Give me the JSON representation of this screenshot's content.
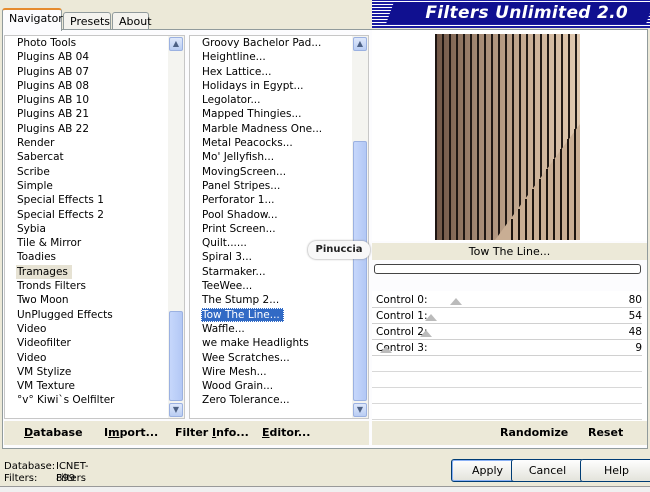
{
  "header": {
    "title": "Filters Unlimited 2.0"
  },
  "tabs": [
    {
      "label": "Navigator",
      "active": true
    },
    {
      "label": "Presets",
      "active": false
    },
    {
      "label": "About",
      "active": false
    }
  ],
  "categories": {
    "items": [
      "Photo Tools",
      "Plugins AB 04",
      "Plugins AB 07",
      "Plugins AB 08",
      "Plugins AB 10",
      "Plugins AB 21",
      "Plugins AB 22",
      "Render",
      "Sabercat",
      "Scribe",
      "Simple",
      "Special Effects 1",
      "Special Effects 2",
      "Sybia",
      "Tile & Mirror",
      "Toadies",
      "Tramages",
      "Tronds Filters",
      "Two Moon",
      "UnPlugged Effects",
      "Video",
      "Videofilter",
      "Video",
      "VM Stylize",
      "VM Texture",
      "°v° Kiwi`s Oelfilter"
    ],
    "selected": "Tramages"
  },
  "filters": {
    "items": [
      "Groovy Bachelor Pad...",
      "Heightline...",
      "Hex Lattice...",
      "Holidays in Egypt...",
      "Legolator...",
      "Mapped Thingies...",
      "Marble Madness One...",
      "Metal Peacocks...",
      "Mo' Jellyfish...",
      "MovingScreen...",
      "Panel Stripes...",
      "Perforator 1...",
      "Pool Shadow...",
      "Print Screen...",
      "Quilt......",
      "Spiral 3...",
      "Starmaker...",
      "TeeWee...",
      "The Stump 2...",
      "Tow The Line...",
      "Waffle...",
      "we make Headlights",
      "Wee Scratches...",
      "Wire Mesh...",
      "Wood Grain...",
      "Zero Tolerance..."
    ],
    "selected": "Tow The Line..."
  },
  "links": {
    "database": {
      "underline": "D",
      "rest": "atabase"
    },
    "import": {
      "pre": "I",
      "underline": "m",
      "rest": "port..."
    },
    "filter_info": {
      "pre": "Filter ",
      "underline": "I",
      "rest": "nfo..."
    },
    "editor": {
      "underline": "E",
      "rest": "ditor..."
    },
    "randomize": "Randomize",
    "reset": "Reset"
  },
  "preview": {
    "filter_name": "Tow The Line...",
    "watermark": "Pinuccia"
  },
  "controls": [
    {
      "label": "Control 0:",
      "value": 80
    },
    {
      "label": "Control 1:",
      "value": 54
    },
    {
      "label": "Control 2:",
      "value": 48
    },
    {
      "label": "Control 3:",
      "value": 9
    }
  ],
  "footer": {
    "database_label": "Database:",
    "database_value": "ICNET-Filters",
    "filters_label": "Filters:",
    "filters_value": "899",
    "apply": "Apply",
    "cancel": "Cancel",
    "help": "Help"
  }
}
